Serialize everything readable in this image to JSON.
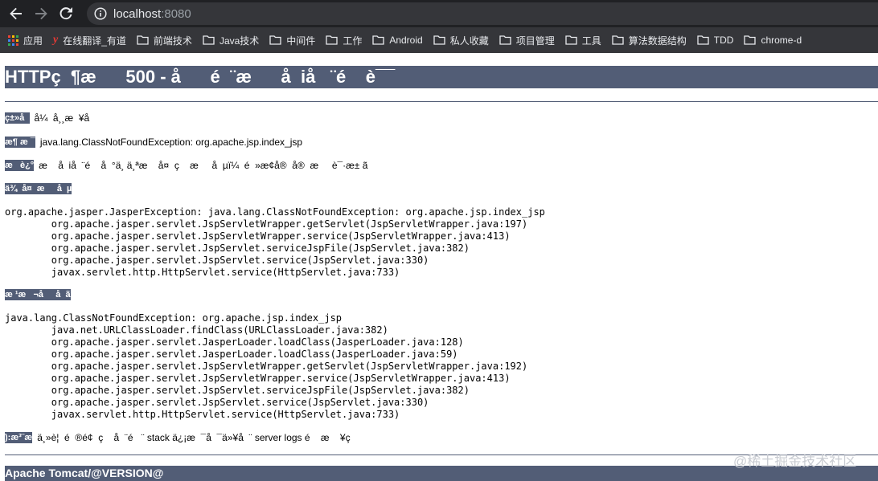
{
  "browser": {
    "url_host": "localhost",
    "url_port": ":8080",
    "bookmarks": [
      {
        "icon": "apps-icon",
        "label": "应用"
      },
      {
        "icon": "youdao-icon",
        "label": "在线翻译_有道"
      },
      {
        "icon": "folder-icon",
        "label": "前端技术"
      },
      {
        "icon": "folder-icon",
        "label": "Java技术"
      },
      {
        "icon": "folder-icon",
        "label": "中间件"
      },
      {
        "icon": "folder-icon",
        "label": "工作"
      },
      {
        "icon": "folder-icon",
        "label": "Android"
      },
      {
        "icon": "folder-icon",
        "label": "私人收藏"
      },
      {
        "icon": "folder-icon",
        "label": "项目管理"
      },
      {
        "icon": "folder-icon",
        "label": "工具"
      },
      {
        "icon": "folder-icon",
        "label": "算法数据结构"
      },
      {
        "icon": "folder-icon",
        "label": "TDD"
      },
      {
        "icon": "folder-icon",
        "label": "chrome-d"
      }
    ]
  },
  "page": {
    "title": "HTTPç  ¶æ      500 - å      é  ¨æ      å  iå   ¨é    è¯¯",
    "type_label": "ç±»å  ",
    "type_value": "å¼  å¸¸æ  ¥å",
    "message_label": "æ¶ æ ¯",
    "message_value": "java.lang.ClassNotFoundException: org.apache.jsp.index_jsp",
    "description_label": "æ   è¿°",
    "description_value": "æ    å  iå  ¨é    å  °ä¸ ä¸ªæ    å¤  ç    æ     å  µï¼  é  »æ¢å®  å®  æ     è¯·æ± ã",
    "exception_label": "ä¾  å¤  æ     å  µ",
    "exception_trace": "org.apache.jasper.JasperException: java.lang.ClassNotFoundException: org.apache.jsp.index_jsp\n\torg.apache.jasper.servlet.JspServletWrapper.getServlet(JspServletWrapper.java:197)\n\torg.apache.jasper.servlet.JspServletWrapper.service(JspServletWrapper.java:413)\n\torg.apache.jasper.servlet.JspServlet.serviceJspFile(JspServlet.java:382)\n\torg.apache.jasper.servlet.JspServlet.service(JspServlet.java:330)\n\tjavax.servlet.http.HttpServlet.service(HttpServlet.java:733)",
    "root_cause_label": "æ ¹æ   ¬å     å  ã",
    "root_cause_trace": "java.lang.ClassNotFoundException: org.apache.jsp.index_jsp\n\tjava.net.URLClassLoader.findClass(URLClassLoader.java:382)\n\torg.apache.jasper.servlet.JasperLoader.loadClass(JasperLoader.java:128)\n\torg.apache.jasper.servlet.JasperLoader.loadClass(JasperLoader.java:59)\n\torg.apache.jasper.servlet.JspServletWrapper.getServlet(JspServletWrapper.java:192)\n\torg.apache.jasper.servlet.JspServletWrapper.service(JspServletWrapper.java:413)\n\torg.apache.jasper.servlet.JspServlet.serviceJspFile(JspServlet.java:382)\n\torg.apache.jasper.servlet.JspServlet.service(JspServlet.java:330)\n\tjavax.servlet.http.HttpServlet.service(HttpServlet.java:733)",
    "note_label": "):æ³¨æ",
    "note_value": "ä¸»è¦  é  ®é¢  ç    å  ¨é   ¨ stack ä¿¡æ  ¯å  ¯ä»¥å  ¨ server logs é    æ    ¥ç",
    "footer": "Apache Tomcat/@VERSION@"
  },
  "watermark": "@稀土掘金技术社区",
  "colors": {
    "tomcat_header": "#525d76",
    "chrome_dark": "#202124",
    "chrome_toolbar": "#35363a"
  }
}
